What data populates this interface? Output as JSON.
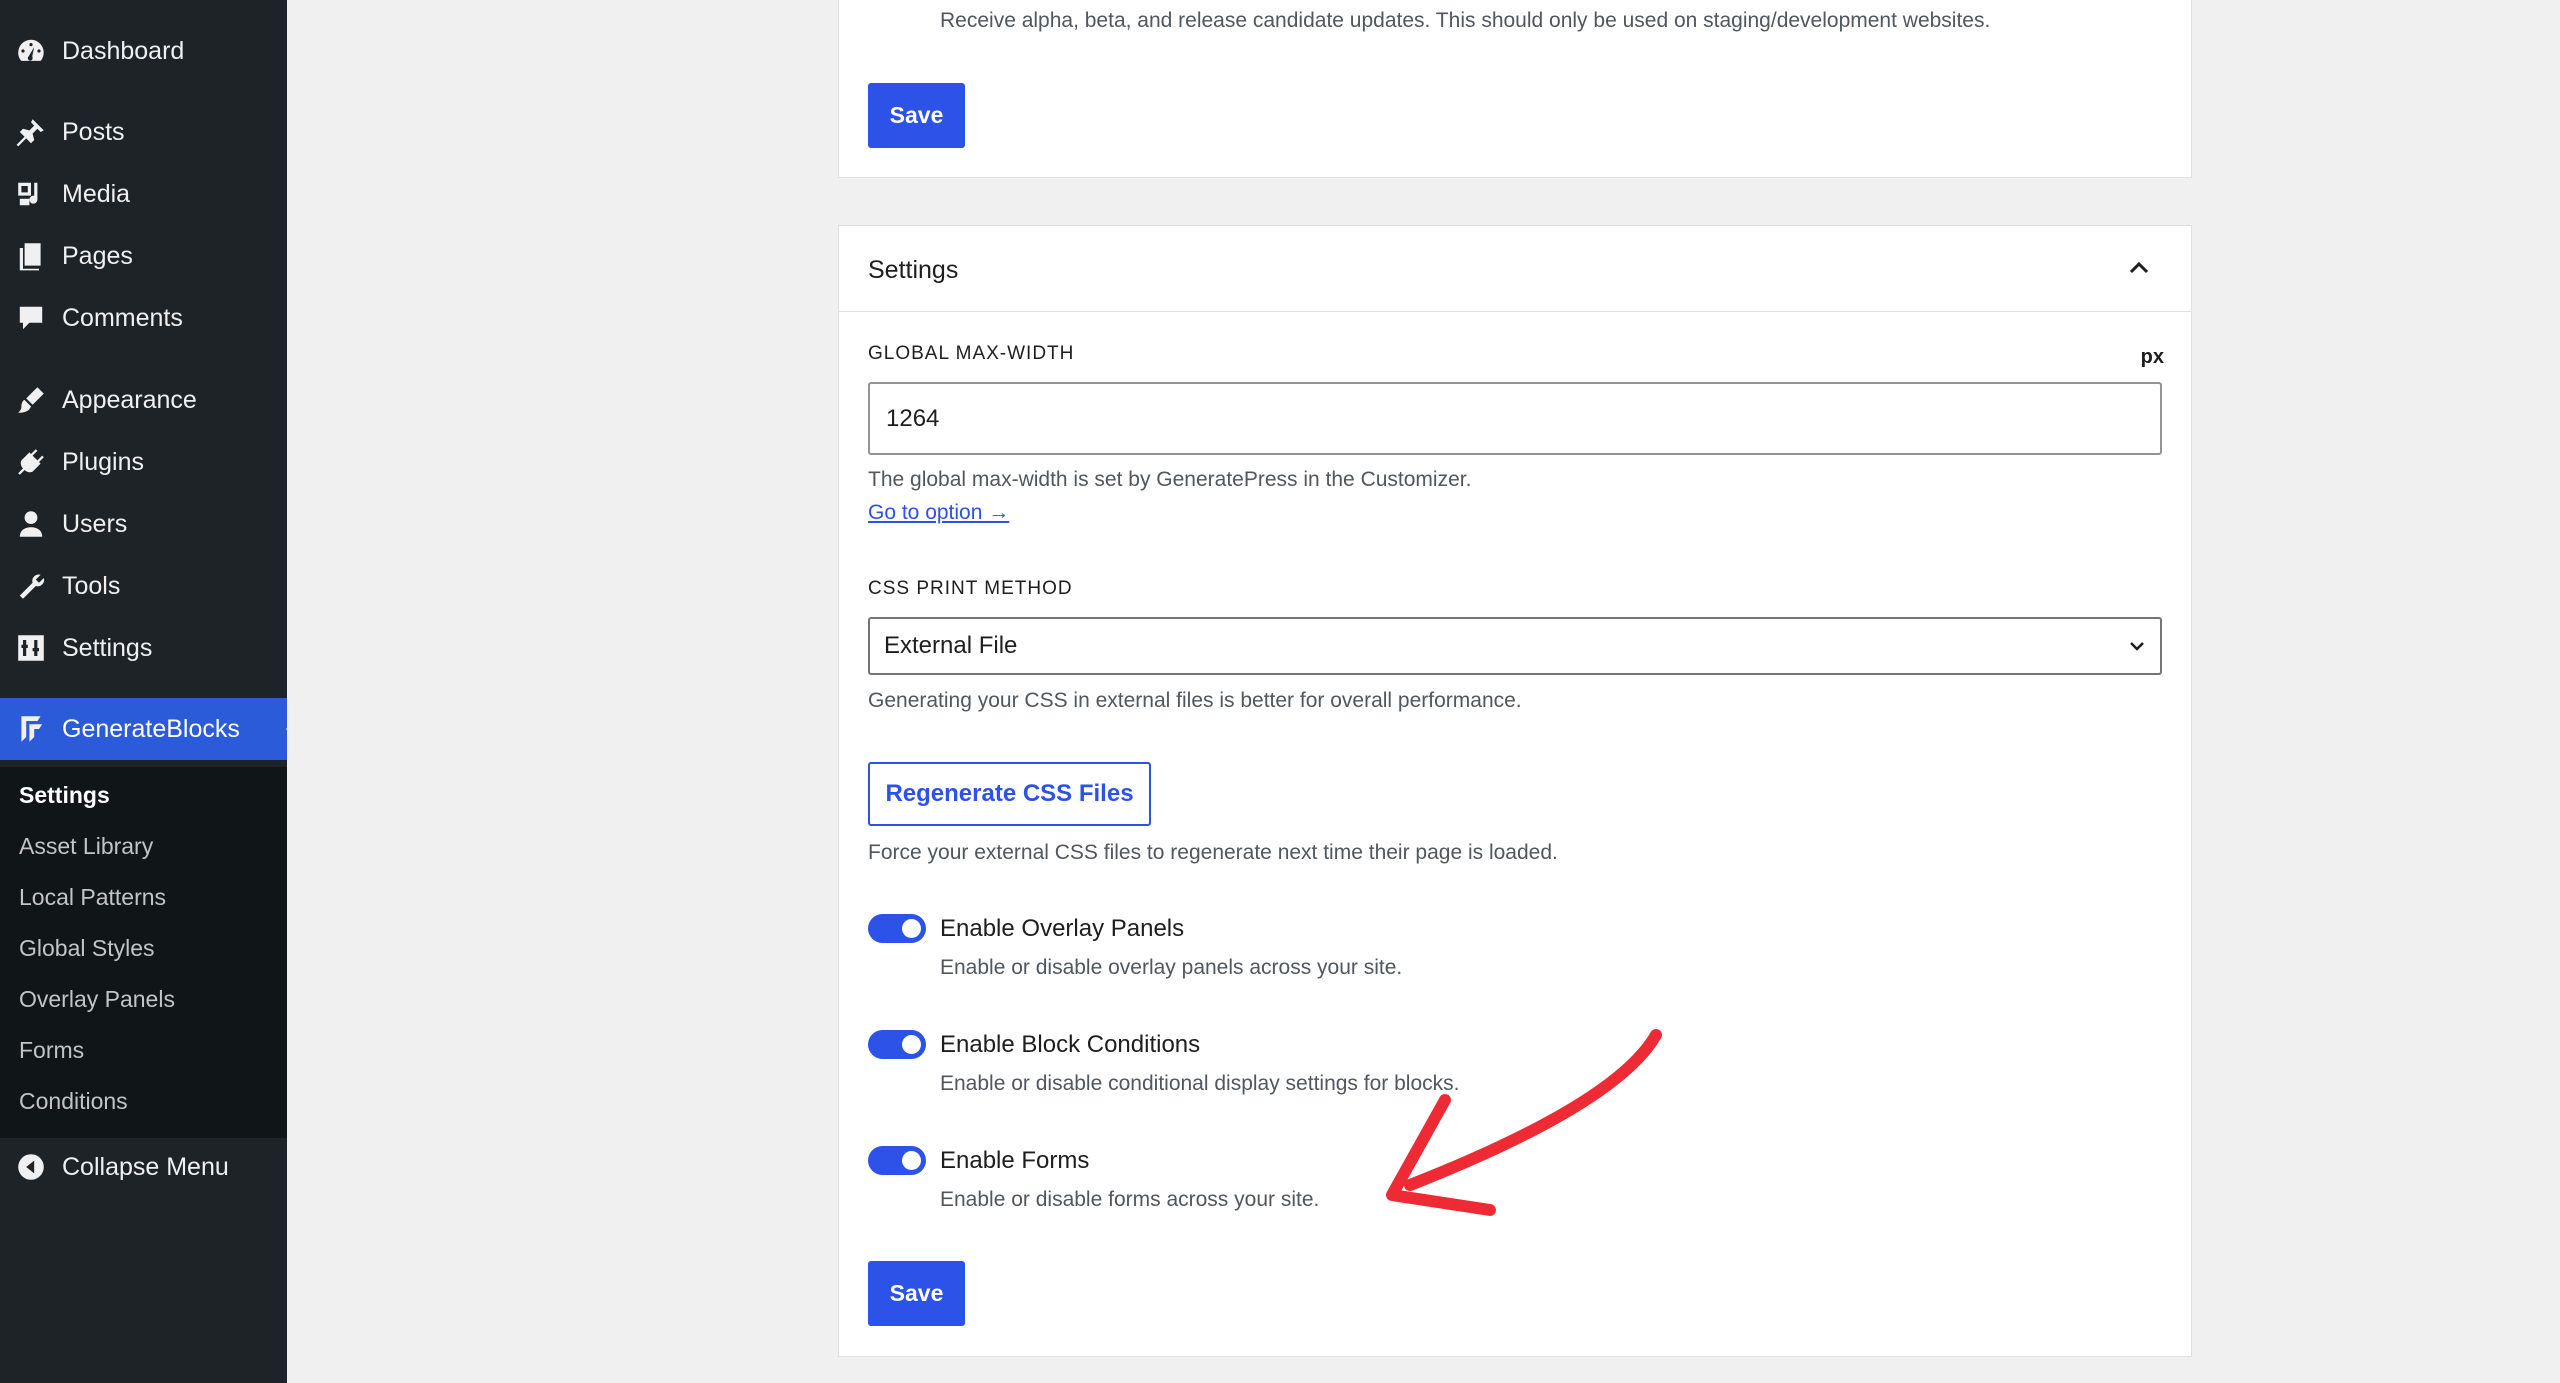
{
  "sidebar": {
    "items": [
      {
        "label": "Dashboard",
        "icon": "dashboard-icon"
      },
      {
        "label": "Posts",
        "icon": "pin-icon"
      },
      {
        "label": "Media",
        "icon": "media-icon"
      },
      {
        "label": "Pages",
        "icon": "pages-icon"
      },
      {
        "label": "Comments",
        "icon": "comment-icon"
      },
      {
        "label": "Appearance",
        "icon": "brush-icon"
      },
      {
        "label": "Plugins",
        "icon": "plugin-icon"
      },
      {
        "label": "Users",
        "icon": "user-icon"
      },
      {
        "label": "Tools",
        "icon": "wrench-icon"
      },
      {
        "label": "Settings",
        "icon": "sliders-icon"
      },
      {
        "label": "GenerateBlocks",
        "icon": "generateblocks-icon"
      }
    ],
    "submenu": [
      "Settings",
      "Asset Library",
      "Local Patterns",
      "Global Styles",
      "Overlay Panels",
      "Forms",
      "Conditions"
    ],
    "collapse_label": "Collapse Menu"
  },
  "top_card": {
    "description": "Receive alpha, beta, and release candidate updates. This should only be used on staging/development websites.",
    "save_label": "Save"
  },
  "settings_card": {
    "title": "Settings",
    "max_width": {
      "label": "GLOBAL MAX-WIDTH",
      "unit": "px",
      "value": "1264",
      "help": "The global max-width is set by GeneratePress in the Customizer.",
      "link": "Go to option →"
    },
    "css_print": {
      "label": "CSS PRINT METHOD",
      "selected": "External File",
      "help": "Generating your CSS in external files is better for overall performance."
    },
    "regenerate": {
      "label": "Regenerate CSS Files",
      "help": "Force your external CSS files to regenerate next time their page is loaded."
    },
    "toggles": [
      {
        "label": "Enable Overlay Panels",
        "help": "Enable or disable overlay panels across your site.",
        "checked": true
      },
      {
        "label": "Enable Block Conditions",
        "help": "Enable or disable conditional display settings for blocks.",
        "checked": true
      },
      {
        "label": "Enable Forms",
        "help": "Enable or disable forms across your site.",
        "checked": true
      }
    ],
    "save_label": "Save"
  },
  "colors": {
    "accent": "#2c52e8",
    "sidebar_bg": "#1d2327",
    "annotation_arrow": "#ee2a35"
  }
}
